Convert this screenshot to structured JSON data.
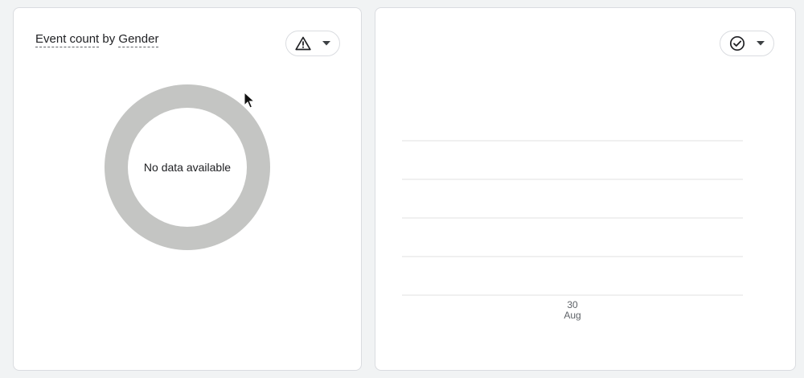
{
  "left_card": {
    "title_metric": "Event count",
    "title_connector": "by",
    "title_dimension": "Gender",
    "status_icon": "warning-triangle-icon",
    "empty_message": "No data available",
    "donut_color": "#c4c5c3"
  },
  "right_card": {
    "status_icon": "check-circle-icon",
    "chart_data": {
      "type": "line",
      "title": "",
      "x": [
        "30 Aug"
      ],
      "x_tick_day": "30",
      "x_tick_month": "Aug",
      "series": [],
      "grid": true,
      "gridline_count": 5
    }
  },
  "colors": {
    "card_border": "#dadce0",
    "gridline": "#e0e0e0",
    "text": "#202124",
    "muted_text": "#5f6368"
  }
}
